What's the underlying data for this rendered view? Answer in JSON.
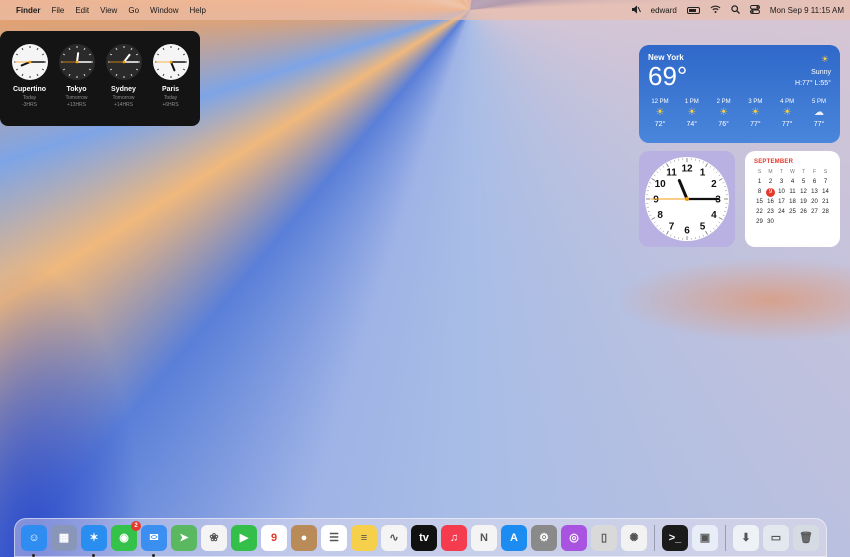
{
  "menubar": {
    "finder": "Finder",
    "menus": [
      "File",
      "Edit",
      "View",
      "Go",
      "Window",
      "Help"
    ],
    "user": "edward",
    "datetime": "Mon Sep 9  11:15 AM"
  },
  "world_clock": [
    {
      "city": "Cupertino",
      "day": "Today",
      "offset": "-3HRS",
      "face": "light",
      "hour": 8,
      "minute": 15
    },
    {
      "city": "Tokyo",
      "day": "Tomorrow",
      "offset": "+13HRS",
      "face": "dark",
      "hour": 0,
      "minute": 15
    },
    {
      "city": "Sydney",
      "day": "Tomorrow",
      "offset": "+14HRS",
      "face": "dark",
      "hour": 1,
      "minute": 15
    },
    {
      "city": "Paris",
      "day": "Today",
      "offset": "+6HRS",
      "face": "light",
      "hour": 5,
      "minute": 15
    }
  ],
  "weather": {
    "location": "New York",
    "temp": "69°",
    "condition": "Sunny",
    "hilo": "H:77° L:55°",
    "hours": [
      {
        "time": "12 PM",
        "icon": "sun-icon",
        "temp": "72°"
      },
      {
        "time": "1 PM",
        "icon": "sun-icon",
        "temp": "74°"
      },
      {
        "time": "2 PM",
        "icon": "sun-icon",
        "temp": "76°"
      },
      {
        "time": "3 PM",
        "icon": "sun-icon",
        "temp": "77°"
      },
      {
        "time": "4 PM",
        "icon": "sun-icon",
        "temp": "77°"
      },
      {
        "time": "5 PM",
        "icon": "partly-cloudy-icon",
        "temp": "77°"
      }
    ]
  },
  "analog_clock": {
    "hour": 11,
    "minute": 15,
    "second": 45
  },
  "calendar": {
    "month": "SEPTEMBER",
    "weekdays": [
      "S",
      "M",
      "T",
      "W",
      "T",
      "F",
      "S"
    ],
    "days": [
      "1",
      "2",
      "3",
      "4",
      "5",
      "6",
      "7",
      "8",
      "9",
      "10",
      "11",
      "12",
      "13",
      "14",
      "15",
      "16",
      "17",
      "18",
      "19",
      "20",
      "21",
      "22",
      "23",
      "24",
      "25",
      "26",
      "27",
      "28",
      "29",
      "30"
    ],
    "today": "9"
  },
  "dock": {
    "apps": [
      {
        "name": "finder",
        "color": "#2f8cf0",
        "glyph": "☺",
        "running": true
      },
      {
        "name": "launchpad",
        "color": "#8a96b8",
        "glyph": "▦",
        "running": false
      },
      {
        "name": "safari",
        "color": "#2a8ef0",
        "glyph": "✶",
        "running": true
      },
      {
        "name": "messages",
        "color": "#35c24a",
        "glyph": "◉",
        "running": false,
        "badge": "2"
      },
      {
        "name": "mail",
        "color": "#3a8ff0",
        "glyph": "✉",
        "running": true
      },
      {
        "name": "maps",
        "color": "#59b860",
        "glyph": "➤",
        "running": false
      },
      {
        "name": "photos",
        "color": "#f4f4f4",
        "glyph": "❀",
        "running": false
      },
      {
        "name": "facetime",
        "color": "#33bf4a",
        "glyph": "▶",
        "running": false
      },
      {
        "name": "calendar",
        "color": "#ffffff",
        "glyph": "9",
        "running": false
      },
      {
        "name": "contacts",
        "color": "#b98b58",
        "glyph": "●",
        "running": false
      },
      {
        "name": "reminders",
        "color": "#ffffff",
        "glyph": "☰",
        "running": false
      },
      {
        "name": "notes",
        "color": "#f6d04a",
        "glyph": "≡",
        "running": false
      },
      {
        "name": "freeform",
        "color": "#f4f4f4",
        "glyph": "∿",
        "running": false
      },
      {
        "name": "apple-tv",
        "color": "#111111",
        "glyph": "tv",
        "running": false
      },
      {
        "name": "music",
        "color": "#f53b4e",
        "glyph": "♫",
        "running": false
      },
      {
        "name": "news",
        "color": "#f4f4f4",
        "glyph": "N",
        "running": false
      },
      {
        "name": "app-store",
        "color": "#1c8cf0",
        "glyph": "A",
        "running": false
      },
      {
        "name": "system-settings",
        "color": "#8a8a8a",
        "glyph": "⚙",
        "running": false
      },
      {
        "name": "podcasts",
        "color": "#a854e0",
        "glyph": "◎",
        "running": false
      },
      {
        "name": "iphone-mirroring",
        "color": "#d9d9d9",
        "glyph": "▯",
        "running": false
      },
      {
        "name": "ladybug-app",
        "color": "#f2f2f2",
        "glyph": "✺",
        "running": false
      },
      {
        "name": "terminal",
        "color": "#1b1b1b",
        "glyph": ">_",
        "running": false
      },
      {
        "name": "preview",
        "color": "#e8eef7",
        "glyph": "▣",
        "running": false
      },
      {
        "name": "downloads",
        "color": "#eef2f7",
        "glyph": "⬇",
        "running": false
      },
      {
        "name": "stack",
        "color": "#e3e8ee",
        "glyph": "▭",
        "running": false
      },
      {
        "name": "trash",
        "color": "#d5dbe3",
        "glyph": "🗑",
        "running": false
      }
    ]
  }
}
